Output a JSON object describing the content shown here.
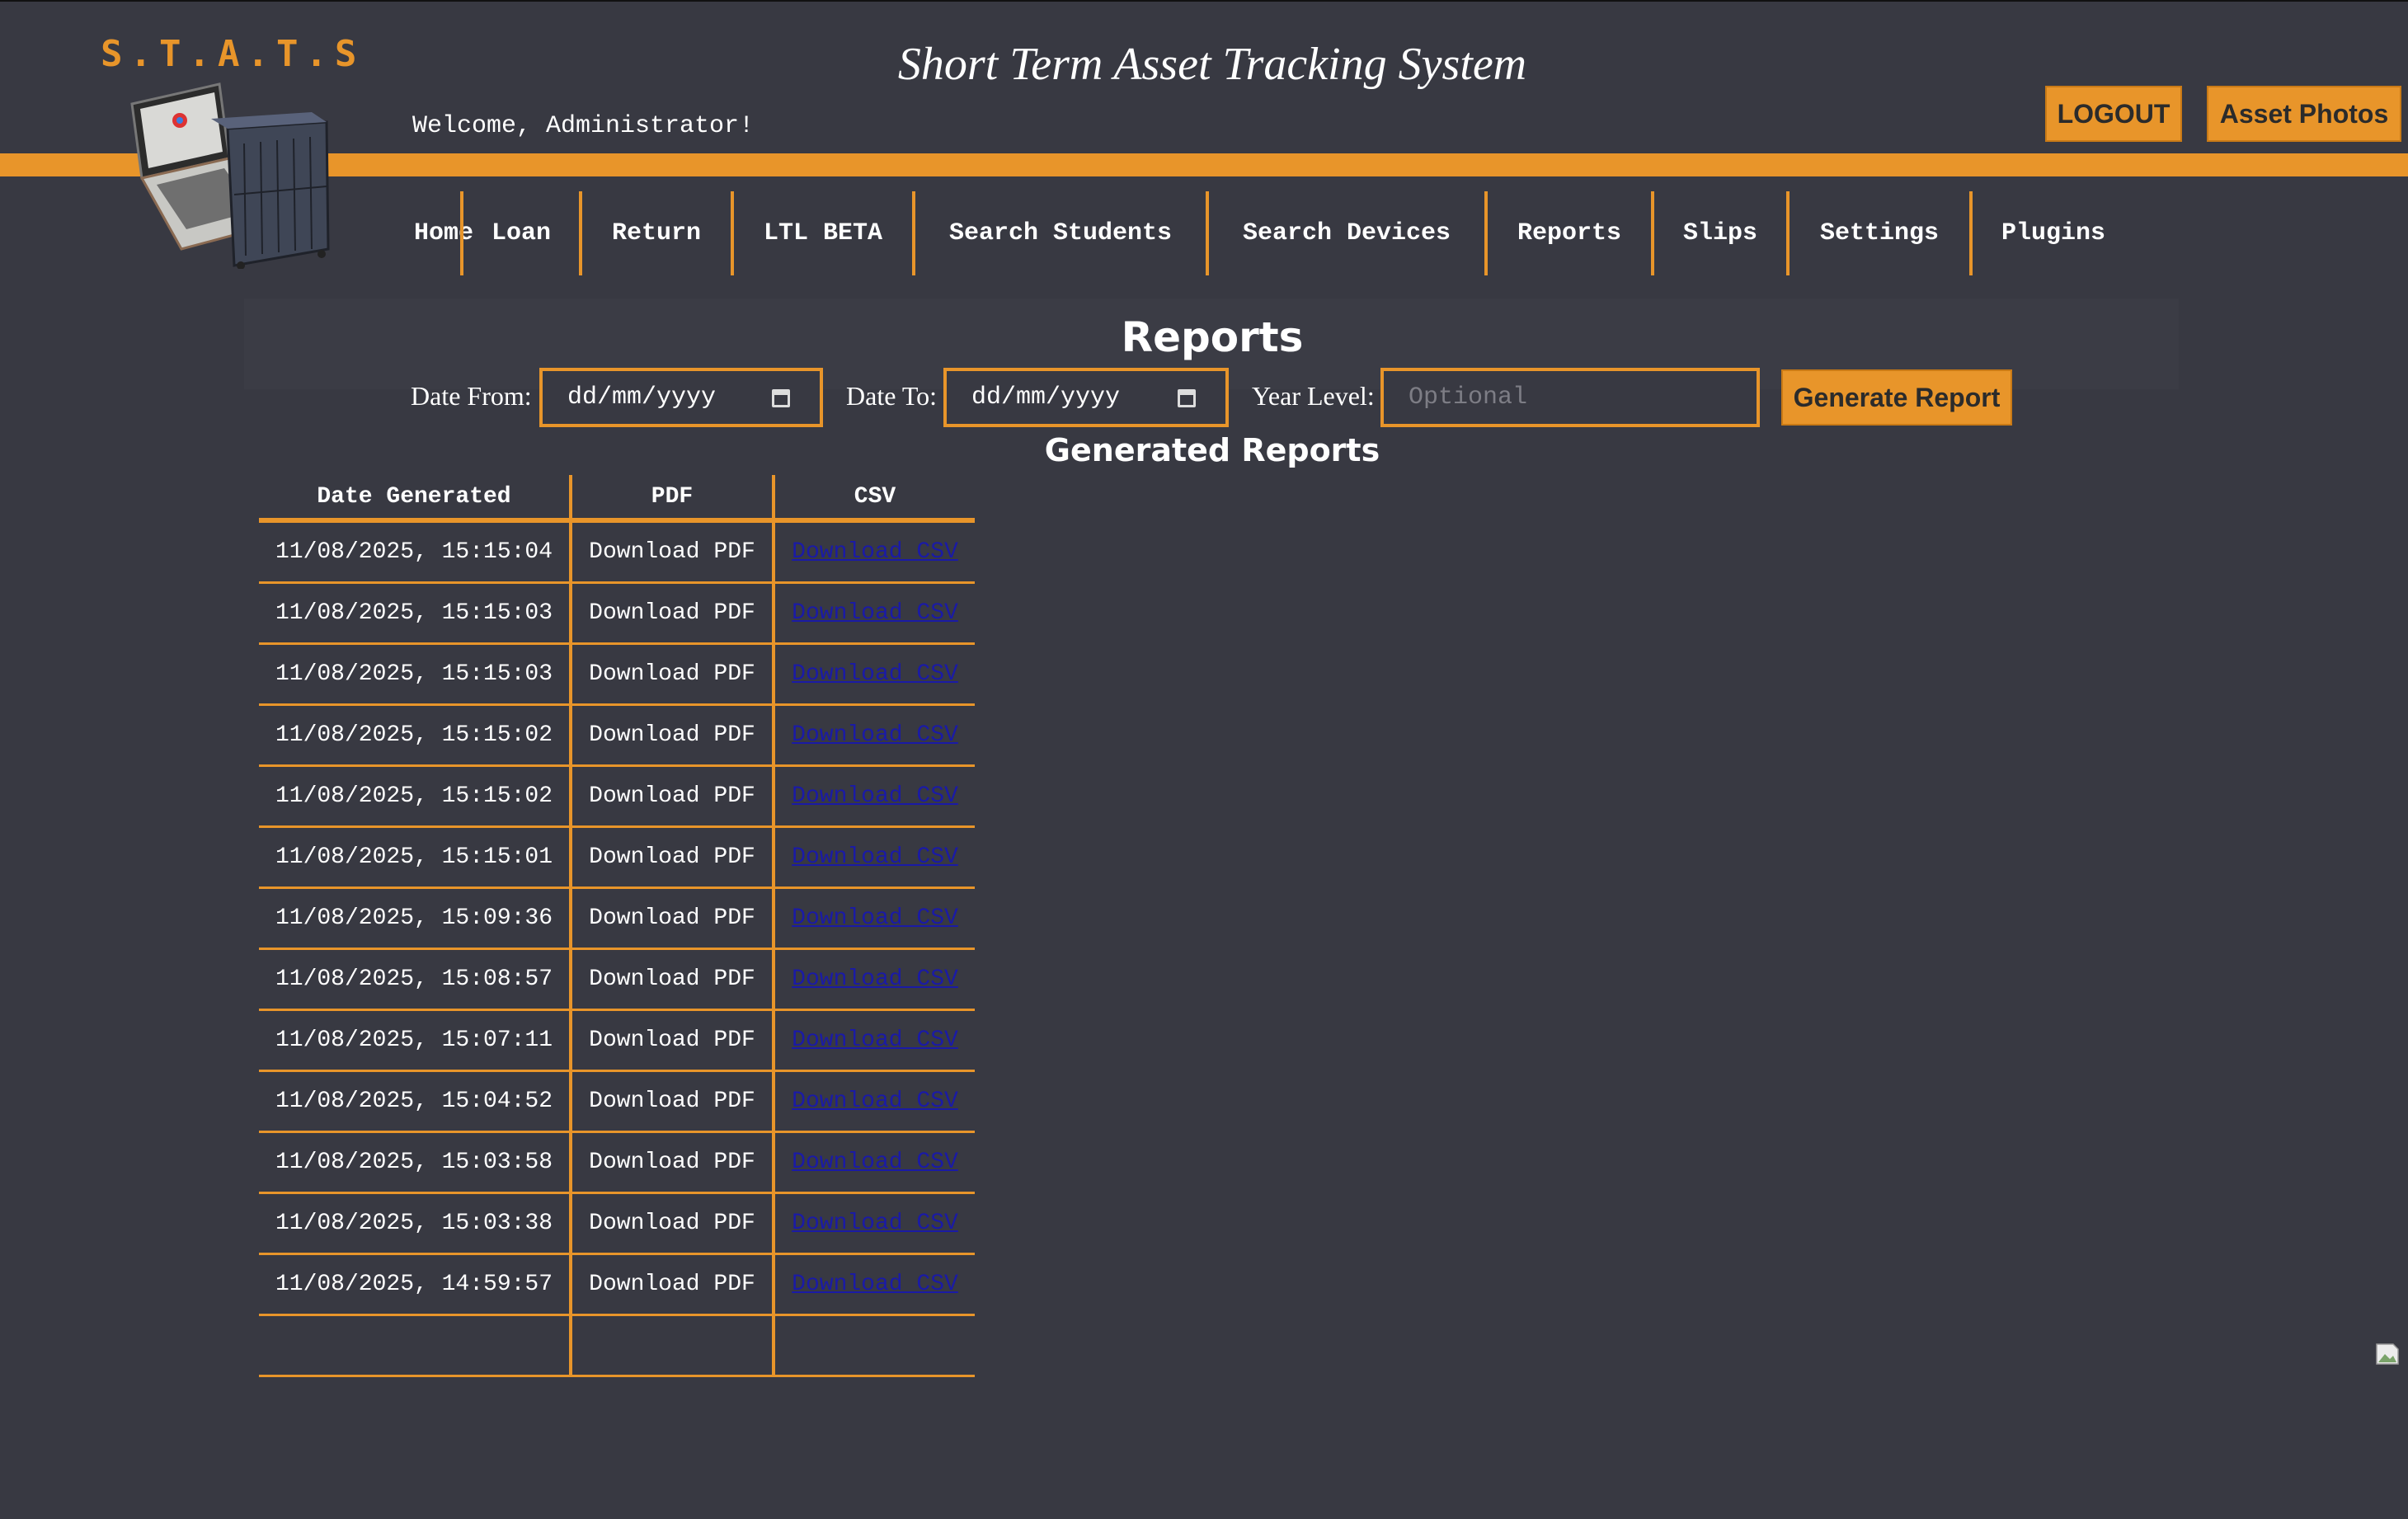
{
  "header": {
    "logo_text": "S.T.A.T.S",
    "site_title": "Short Term Asset Tracking System",
    "welcome": "Welcome, Administrator!",
    "logout_label": "LOGOUT",
    "asset_photos_label": "Asset Photos"
  },
  "nav": {
    "items": [
      "Home",
      "Loan",
      "Return",
      "LTL BETA",
      "Search Students",
      "Search Devices",
      "Reports",
      "Slips",
      "Settings",
      "Plugins"
    ]
  },
  "reports": {
    "title": "Reports",
    "date_from_label": "Date From:",
    "date_from_value": "dd/mm/yyyy",
    "date_to_label": "Date To:",
    "date_to_value": "dd/mm/yyyy",
    "year_level_label": "Year Level:",
    "year_level_placeholder": "Optional",
    "generate_label": "Generate Report",
    "generated_title": "Generated Reports",
    "columns": [
      "Date Generated",
      "PDF",
      "CSV"
    ],
    "rows": [
      {
        "date": "11/08/2025, 15:15:04",
        "pdf": "Download PDF",
        "csv": "Download CSV"
      },
      {
        "date": "11/08/2025, 15:15:03",
        "pdf": "Download PDF",
        "csv": "Download CSV"
      },
      {
        "date": "11/08/2025, 15:15:03",
        "pdf": "Download PDF",
        "csv": "Download CSV"
      },
      {
        "date": "11/08/2025, 15:15:02",
        "pdf": "Download PDF",
        "csv": "Download CSV"
      },
      {
        "date": "11/08/2025, 15:15:02",
        "pdf": "Download PDF",
        "csv": "Download CSV"
      },
      {
        "date": "11/08/2025, 15:15:01",
        "pdf": "Download PDF",
        "csv": "Download CSV"
      },
      {
        "date": "11/08/2025, 15:09:36",
        "pdf": "Download PDF",
        "csv": "Download CSV"
      },
      {
        "date": "11/08/2025, 15:08:57",
        "pdf": "Download PDF",
        "csv": "Download CSV"
      },
      {
        "date": "11/08/2025, 15:07:11",
        "pdf": "Download PDF",
        "csv": "Download CSV"
      },
      {
        "date": "11/08/2025, 15:04:52",
        "pdf": "Download PDF",
        "csv": "Download CSV"
      },
      {
        "date": "11/08/2025, 15:03:58",
        "pdf": "Download PDF",
        "csv": "Download CSV"
      },
      {
        "date": "11/08/2025, 15:03:38",
        "pdf": "Download PDF",
        "csv": "Download CSV"
      },
      {
        "date": "11/08/2025, 14:59:57",
        "pdf": "Download PDF",
        "csv": "Download CSV"
      }
    ]
  },
  "colors": {
    "background": "#383942",
    "accent": "#e8952a",
    "link": "#1a1aa6"
  }
}
